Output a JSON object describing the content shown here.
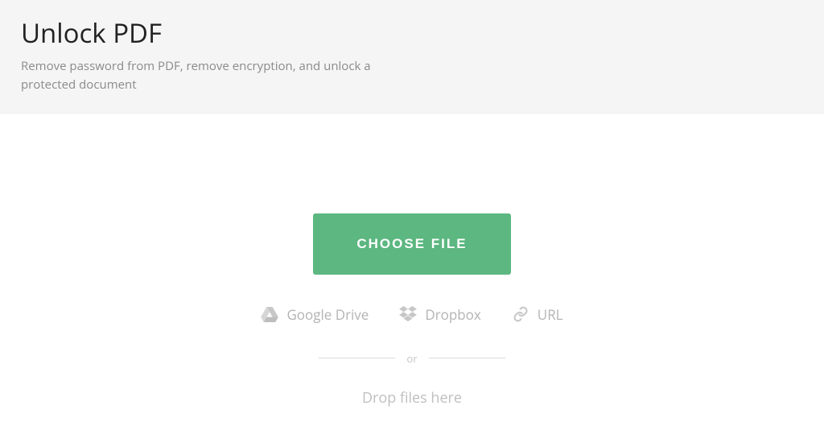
{
  "header": {
    "title": "Unlock PDF",
    "subtitle": "Remove password from PDF, remove encryption, and unlock a protected document"
  },
  "main": {
    "choose_label": "CHOOSE FILE",
    "sources": {
      "google_drive": "Google Drive",
      "dropbox": "Dropbox",
      "url": "URL"
    },
    "separator": "or",
    "drop_label": "Drop files here"
  }
}
